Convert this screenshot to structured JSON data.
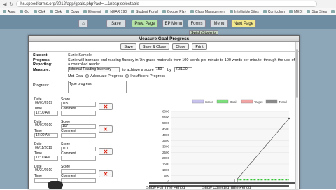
{
  "browser": {
    "url": "hs.speedforms.org/2012/app/goals.php?act=...&nbsp;selectable",
    "bookmarks": [
      "Apps",
      "Go",
      "Clok",
      "Clok",
      "Doug",
      "Element",
      "NEAR 190",
      "Student Portal",
      "Google Play",
      "Class Management",
      "Intelligible Sites",
      "Curriculum",
      "MEDI",
      "Star Sites",
      "Acc..."
    ]
  },
  "app": {
    "top_buttons": [
      "Save",
      "Prev. Page",
      "IEP Menu",
      "Forms",
      "Menu",
      "Next Page"
    ],
    "sub_button": "Switch Students"
  },
  "modal": {
    "title": "Measure Goal Progress",
    "toolbar": [
      "Save",
      "Save & Close",
      "Close",
      "Print"
    ],
    "student_label": "Student:",
    "student_name": "Suzie Sample",
    "progress_label": "Progress Reporting:",
    "progress_text": "Suzie will increase oral reading fluency in 7th grade materials from 100 words per minute to 100 words per minute, through the use of a controlled reader.",
    "measure_label": "Measure:",
    "measure_select": "Informal Reading Inventory",
    "measure_to": "to achieve a score of",
    "measure_score": "150",
    "measure_by": "by",
    "measure_date": "7/31/20",
    "radios": [
      "Met Goal",
      "Adequate Progress",
      "Insufficient Progress"
    ],
    "progress_field_label": "Progress:",
    "progress_field_value": "Type progress",
    "entries": [
      {
        "date_label": "Date",
        "date": "06/01/2019",
        "score_label": "Score",
        "score": "105",
        "time_label": "Time",
        "time": "12:00 AM",
        "comment_label": "Comment"
      },
      {
        "date_label": "Date",
        "date": "06/07/2019",
        "score_label": "Score",
        "score": "107",
        "time_label": "Time",
        "time": "12:00 AM",
        "comment_label": "Comment"
      },
      {
        "date_label": "Date",
        "date": "06/11/2019",
        "score_label": "Score",
        "score": "110",
        "time_label": "Time",
        "time": "12:00 AM",
        "comment_label": "Comment"
      },
      {
        "date_label": "Date",
        "date": "06/21/2019",
        "score_label": "Score",
        "score": "",
        "time_label": "Time",
        "time": "",
        "comment_label": "Comment"
      }
    ],
    "delete_glyph": "✕",
    "show_full": "Show Full Time Period",
    "show_collected": "Show Collected Time Period"
  },
  "chart_data": {
    "type": "line",
    "title": "",
    "legend": [
      "Score",
      "Goal",
      "Target",
      "Trend"
    ],
    "legend_colors": [
      "#c7c3ee",
      "#7be07b",
      "#f2a3a3",
      "#8a8a8a"
    ],
    "y_ticks": [
      "6000",
      "5500",
      "5000",
      "4500",
      "4000",
      "3500",
      "3000",
      "2500",
      "2000",
      "1500",
      "1000",
      "500",
      "0"
    ],
    "ylim": [
      0,
      6000
    ],
    "grid": true,
    "legend_position": "top",
    "series": [
      {
        "name": "Goal",
        "values": [
          150,
          150
        ],
        "color": "#33c433"
      },
      {
        "name": "Trend",
        "values": [
          105,
          5400
        ],
        "color": "#555555"
      }
    ]
  }
}
